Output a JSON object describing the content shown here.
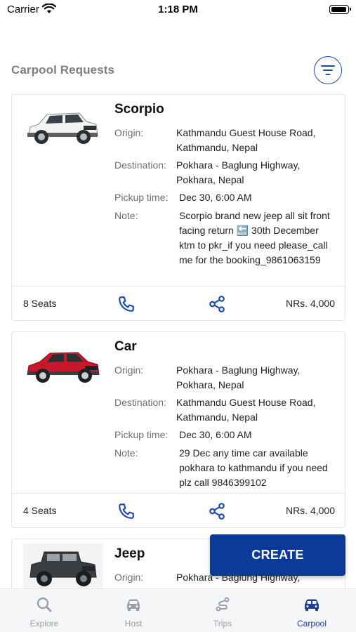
{
  "status_bar": {
    "carrier": "Carrier",
    "time": "1:18 PM"
  },
  "header": {
    "title": "Carpool Requests",
    "filter_icon": "filter-icon"
  },
  "labels": {
    "origin": "Origin:",
    "destination": "Destination:",
    "pickup_time": "Pickup time:",
    "note": "Note:"
  },
  "cards": [
    {
      "title": "Scorpio",
      "origin": "Kathmandu Guest House Road, Kathmandu, Nepal",
      "destination": "Pokhara - Baglung Highway, Pokhara, Nepal",
      "pickup_time": "Dec 30, 6:00 AM",
      "note": "Scorpio brand new jeep all sit front facing return 🔙 30th December ktm to pkr_if you need please_call me for the booking_9861063159",
      "seats": "8 Seats",
      "price": "NRs. 4,000",
      "car_color": "#f2f2f2"
    },
    {
      "title": "Car",
      "origin": "Pokhara - Baglung Highway, Pokhara, Nepal",
      "destination": "Kathmandu Guest House Road, Kathmandu, Nepal",
      "pickup_time": "Dec 30, 6:00 AM",
      "note": "29 Dec  any time  car available pokhara to kathmandu if you need plz call 9846399102",
      "seats": "4 Seats",
      "price": "NRs. 4,000",
      "car_color": "#c8192b"
    },
    {
      "title": "Jeep",
      "origin": "Pokhara - Baglung Highway,",
      "car_color": "#3a3d42"
    }
  ],
  "create_button": {
    "label": "CREATE"
  },
  "tabs": [
    {
      "label": "Explore",
      "icon": "search-icon",
      "active": false
    },
    {
      "label": "Host",
      "icon": "car-icon",
      "active": false
    },
    {
      "label": "Trips",
      "icon": "route-icon",
      "active": false
    },
    {
      "label": "Carpool",
      "icon": "carpool-icon",
      "active": true
    }
  ],
  "colors": {
    "accent": "#0b3a98",
    "icon_blue": "#1e4aa8",
    "inactive": "#9aa0a6"
  }
}
